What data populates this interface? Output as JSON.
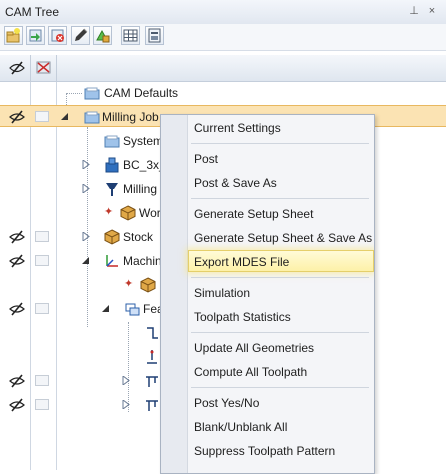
{
  "window": {
    "title": "CAM Tree",
    "pin_glyph": "⊥",
    "close_glyph": "×"
  },
  "toolbar": {
    "buttons": [
      "new-job-icon",
      "import-icon",
      "delete-icon",
      "pencil-icon",
      "green-arrow-icon",
      "grid-icon",
      "settings-sheet-icon"
    ]
  },
  "tree": {
    "items": [
      {
        "label": "CAM Defaults",
        "icon": "folder-icon"
      },
      {
        "label": "Milling Job",
        "icon": "folder-icon",
        "selected": true
      },
      {
        "label": "System",
        "icon": "folder-icon"
      },
      {
        "label": "BC_3x_",
        "icon": "machine-icon"
      },
      {
        "label": "Milling",
        "icon": "tool-icon"
      },
      {
        "label": "Wor",
        "icon": "workpiece-icon"
      },
      {
        "label": "Stock",
        "icon": "stock-box-icon"
      },
      {
        "label": "Machin",
        "icon": "axes-icon"
      },
      {
        "label": "",
        "icon": "part-box-icon"
      },
      {
        "label": "Fea",
        "icon": "features-icon"
      }
    ]
  },
  "context_menu": {
    "items": [
      "Current Settings",
      "Post",
      "Post & Save As",
      "Generate Setup Sheet",
      "Generate Setup Sheet & Save As",
      "Export MDES File",
      "Simulation",
      "Toolpath Statistics",
      "Update All Geometries",
      "Compute All Toolpath",
      "Post Yes/No",
      "Blank/Unblank All",
      "Suppress Toolpath Pattern"
    ],
    "highlighted": "Export MDES File"
  }
}
